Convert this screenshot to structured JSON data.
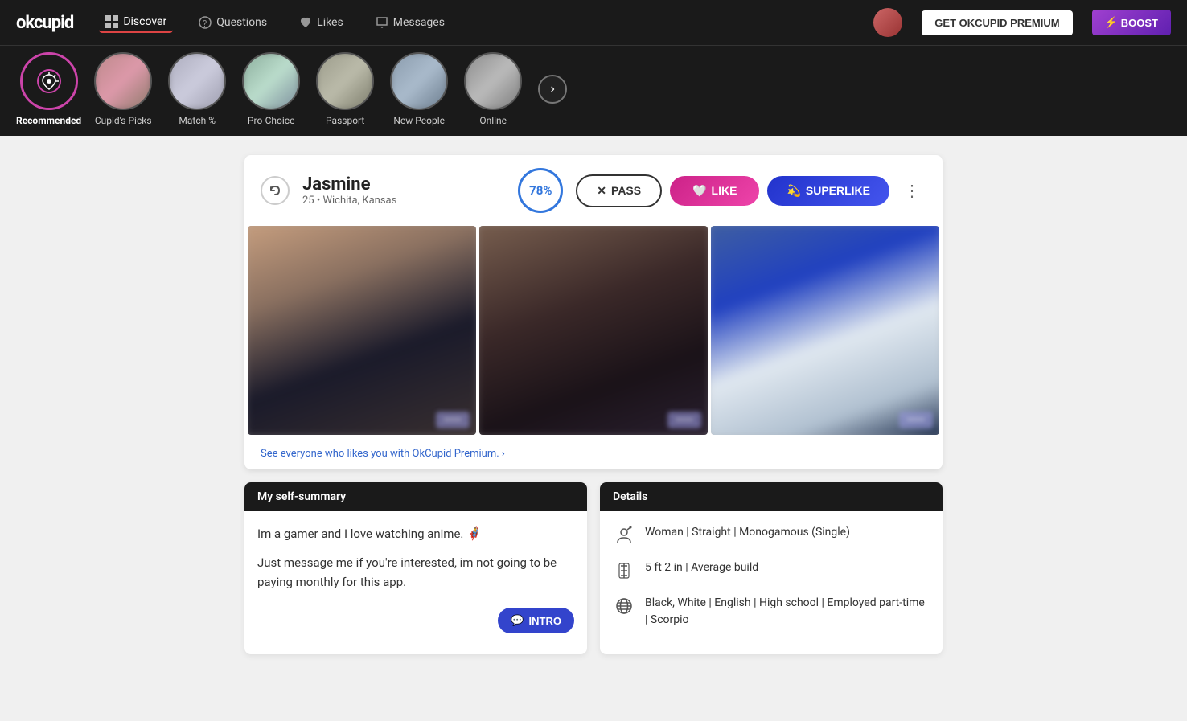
{
  "brand": {
    "name": "okcupid"
  },
  "nav": {
    "items": [
      {
        "id": "discover",
        "label": "Discover",
        "active": true,
        "icon": "grid"
      },
      {
        "id": "questions",
        "label": "Questions",
        "active": false,
        "icon": "chat"
      },
      {
        "id": "likes",
        "label": "Likes",
        "active": false,
        "icon": "heart"
      },
      {
        "id": "messages",
        "label": "Messages",
        "active": false,
        "icon": "message"
      }
    ],
    "premium_btn": "GET OKCUPID PREMIUM",
    "boost_btn": "⚡ BOOST"
  },
  "categories": [
    {
      "id": "recommended",
      "label": "Recommended",
      "active": true
    },
    {
      "id": "cupids-picks",
      "label": "Cupid's Picks",
      "active": false
    },
    {
      "id": "match",
      "label": "Match %",
      "active": false
    },
    {
      "id": "pro-choice",
      "label": "Pro-Choice",
      "active": false
    },
    {
      "id": "passport",
      "label": "Passport",
      "active": false
    },
    {
      "id": "new-people",
      "label": "New People",
      "active": false
    },
    {
      "id": "online",
      "label": "Online",
      "active": false
    }
  ],
  "profile": {
    "name": "Jasmine",
    "age": "25",
    "location": "Wichita, Kansas",
    "match_percent": "78%",
    "pass_label": "PASS",
    "like_label": "LIKE",
    "superlike_label": "SUPERLIKE",
    "premium_link": "See everyone who likes you with OkCupid Premium. ›",
    "self_summary_header": "My self-summary",
    "self_summary_line1": "Im a gamer and I love watching anime. 🦸",
    "self_summary_line2": "Just message me if you're interested, im not going to be paying monthly for this app.",
    "intro_btn": "INTRO",
    "details_header": "Details",
    "details": [
      {
        "id": "orientation",
        "text": "Woman | Straight | Monogamous (Single)",
        "icon": "person"
      },
      {
        "id": "height",
        "text": "5 ft 2 in | Average build",
        "icon": "height"
      },
      {
        "id": "background",
        "text": "Black, White | English | High school | Employed part-time | Scorpio",
        "icon": "globe"
      }
    ]
  }
}
